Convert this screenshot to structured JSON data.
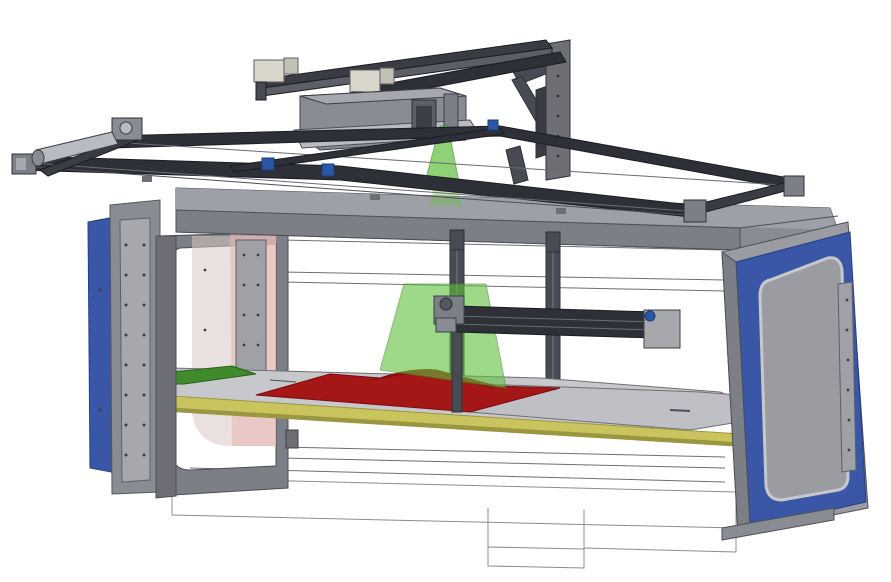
{
  "figure": {
    "background": "#ffffff",
    "colors": {
      "frame_blue": "#3a56a6",
      "frame_blue_dark": "#263f86",
      "panel_grey": "#8a8c94",
      "panel_grey_light": "#b9bbc2",
      "panel_grey_dark": "#5d5f66",
      "rail_dark": "#2e3038",
      "rail_mid": "#494b54",
      "floor_yellow": "#c9c45e",
      "floor_yellow_dark": "#9b9640",
      "sediment_red": "#a51616",
      "sediment_red_dark": "#7c0d0d",
      "laser_green": "#5fbf3c",
      "grass_green": "#3f8a2a",
      "bed_grey": "#c7c8cc",
      "outline": "#6e6f75",
      "connector_blue": "#2a57a8"
    },
    "components": [
      "gantry-carriage",
      "laser-scanner-top",
      "laser-scanner-lower",
      "x-rail-front",
      "x-rail-back",
      "y-beam",
      "flume-channel",
      "flume-end-frame-left",
      "flume-end-frame-right",
      "sediment-bed",
      "support-base"
    ]
  }
}
